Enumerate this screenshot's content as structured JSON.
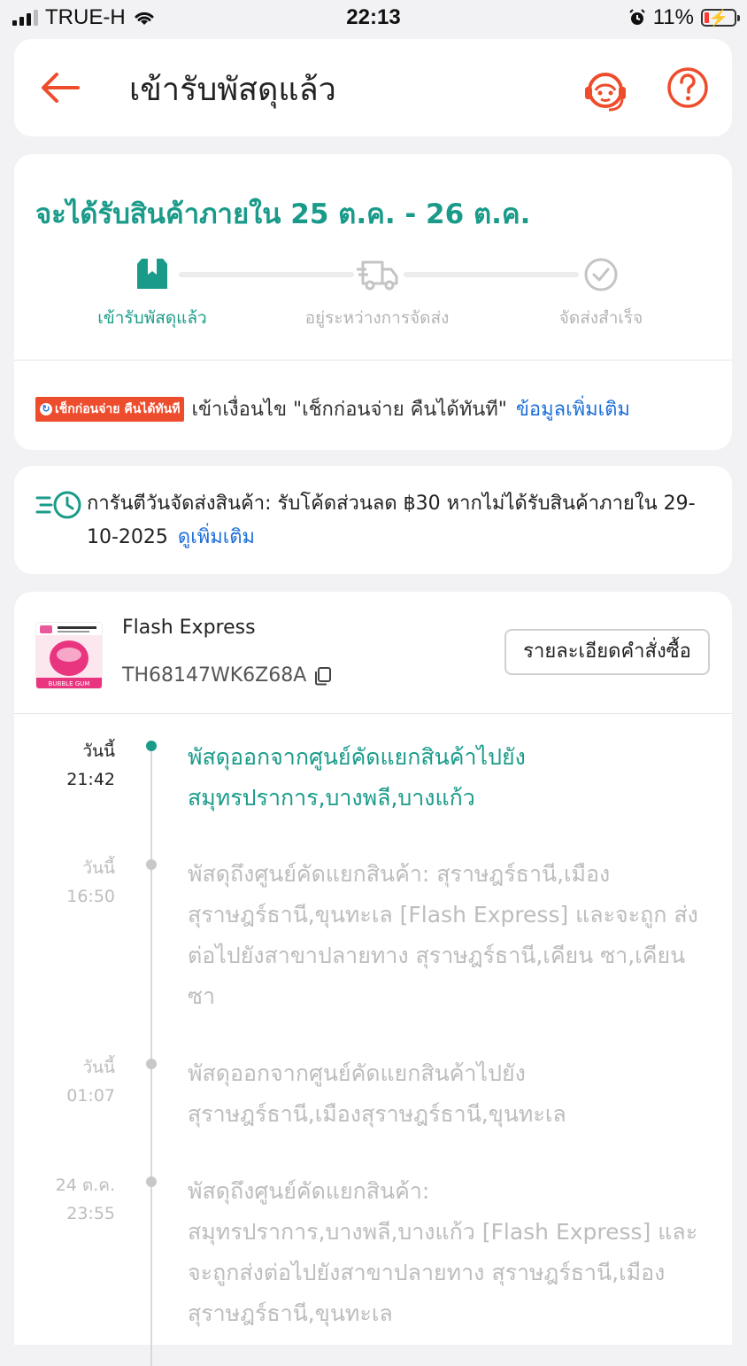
{
  "status_bar": {
    "carrier": "TRUE-H",
    "time": "22:13",
    "battery": "11%"
  },
  "header": {
    "title": "เข้ารับพัสดุแล้ว",
    "back_icon": "back-arrow-icon",
    "cs_icon": "customer-service-icon",
    "help_icon": "help-icon"
  },
  "delivery": {
    "eta": "จะได้รับสินค้าภายใน 25 ต.ค. - 26 ต.ค.",
    "steps": [
      {
        "label": "เข้ารับพัสดุแล้ว",
        "icon": "package-icon",
        "active": true
      },
      {
        "label": "อยู่ระหว่างการจัดส่ง",
        "icon": "truck-icon",
        "active": false
      },
      {
        "label": "จัดส่งสำเร็จ",
        "icon": "check-circle-icon",
        "active": false
      }
    ],
    "cbr_badge": "เช็กก่อนจ่าย คืนได้ทันที",
    "cbr_text": "เข้าเงื่อนไข \"เช็กก่อนจ่าย คืนได้ทันที\"",
    "cbr_link": "ข้อมูลเพิ่มเติม"
  },
  "guarantee": {
    "text": "การันตีวันจัดส่งสินค้า: รับโค้ดส่วนลด ฿30 หากไม่ได้รับสินค้าภายใน 29-10-2025",
    "link": "ดูเพิ่มเติม"
  },
  "shipment": {
    "courier": "Flash Express",
    "tracking_number": "TH68147WK6Z68A",
    "order_details_button": "รายละเอียดคำสั่งซื้อ",
    "thumb_label": "BUBBLE GUM"
  },
  "events": [
    {
      "day": "วันนี้",
      "time": "21:42",
      "text": "พัสดุออกจากศูนย์คัดแยกสินค้าไปยัง สมุทรปราการ,บางพลี,บางแก้ว",
      "active": true
    },
    {
      "day": "วันนี้",
      "time": "16:50",
      "text": "พัสดุถึงศูนย์คัดแยกสินค้า: สุราษฎร์ธานี,เมือง สุราษฎร์ธานี,ขุนทะเล  [Flash Express] และจะถูก ส่งต่อไปยังสาขาปลายทาง สุราษฎร์ธานี,เคียน ซา,เคียนซา",
      "active": false
    },
    {
      "day": "วันนี้",
      "time": "01:07",
      "text": "พัสดุออกจากศูนย์คัดแยกสินค้าไปยัง สุราษฎร์ธานี,เมืองสุราษฎร์ธานี,ขุนทะเล",
      "active": false
    },
    {
      "day": "24 ต.ค.",
      "time": "23:55",
      "text": "พัสดุถึงศูนย์คัดแยกสินค้า: สมุทรปราการ,บางพลี,บางแก้ว  [Flash Express] และจะถูกส่งต่อไปยังสาขาปลายทาง สุราษฎร์ธานี,เมืองสุราษฎร์ธานี,ขุนทะเล",
      "active": false
    }
  ],
  "colors": {
    "accent": "#1a9b8a",
    "primary": "#ee4d2d",
    "link": "#1e6fd9"
  }
}
